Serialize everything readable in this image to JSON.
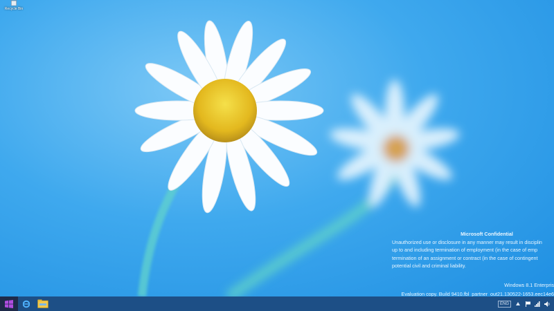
{
  "desktop": {
    "icons": [
      {
        "label": "Recycle Bin",
        "icon": "recycle-bin-icon"
      }
    ]
  },
  "watermark": {
    "confidential_title": "Microsoft Confidential",
    "confidential_lines": [
      "Unauthorized use or disclosure in any manner may result in disciplin",
      "up to and including termination of employment (in the case of emp",
      "termination of an assignment or contract (in the case of contingent",
      "potential civil and criminal liability."
    ],
    "edition": "Windows 8.1 Enterpris",
    "build": "Evaluation copy. Build 9410.fbl_partner_out21.130522-1653.eec14e6"
  },
  "taskbar": {
    "start": "windows-logo-icon",
    "pinned": [
      "internet-explorer-icon",
      "file-explorer-icon"
    ],
    "tray": {
      "keyboard": "ENG",
      "icons": [
        "chevron-up-icon",
        "flag-icon",
        "network-icon",
        "volume-icon"
      ]
    }
  },
  "colors": {
    "taskbar": "#1d4f86",
    "start_button": "#1e2a4a",
    "sky": "#3fa9ee"
  }
}
